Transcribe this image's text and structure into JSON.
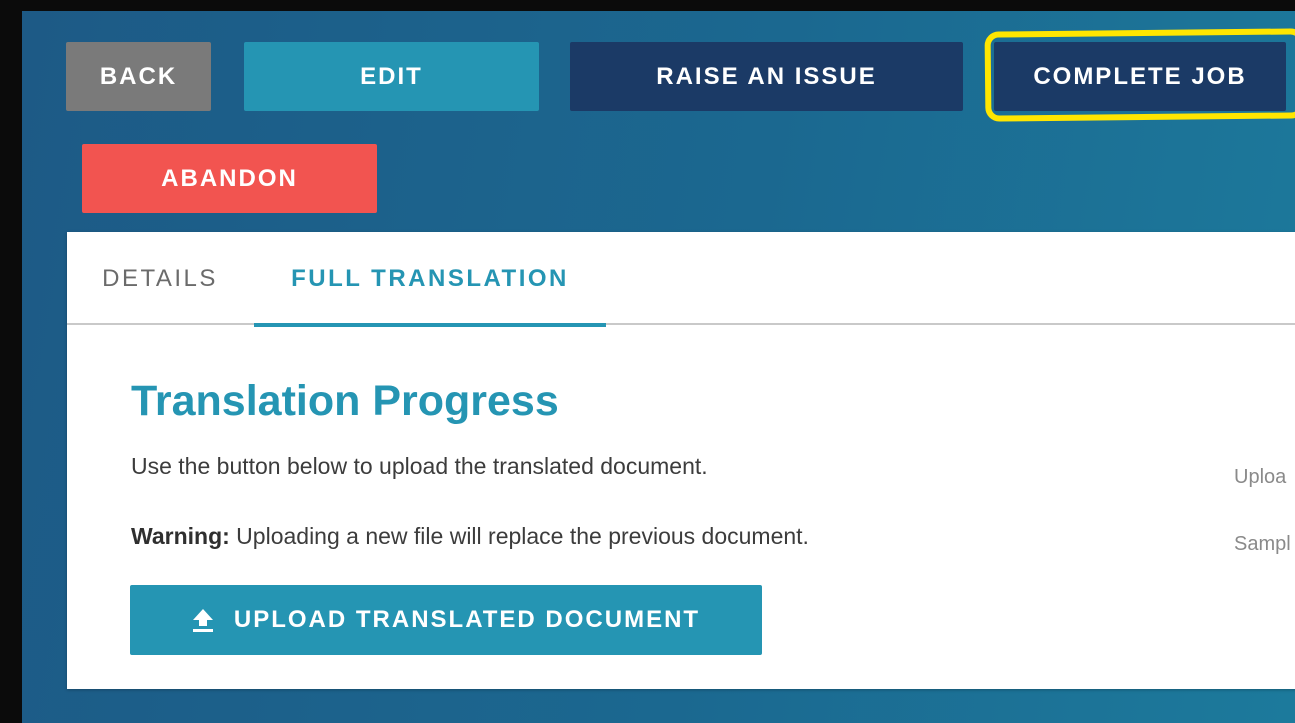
{
  "toolbar": {
    "back_label": "BACK",
    "edit_label": "EDIT",
    "raise_issue_label": "RAISE AN ISSUE",
    "complete_job_label": "COMPLETE JOB",
    "abandon_label": "ABANDON"
  },
  "tabs": [
    {
      "label": "DETAILS",
      "active": false
    },
    {
      "label": "FULL TRANSLATION",
      "active": true
    }
  ],
  "content": {
    "title": "Translation Progress",
    "instruction": "Use the button below to upload the translated document.",
    "warning_prefix": "Warning:",
    "warning_text": " Uploading a new file will replace the previous document.",
    "upload_button_label": "UPLOAD TRANSLATED DOCUMENT",
    "upload_icon": "upload-arrow-icon"
  },
  "side_panel": {
    "label_1": "Uploa",
    "label_2": "Sampl"
  },
  "colors": {
    "accent": "#2595b3",
    "dark_button": "#1b3a66",
    "back_button": "#7a7a7a",
    "danger": "#f25450",
    "highlight": "#ffe600"
  }
}
